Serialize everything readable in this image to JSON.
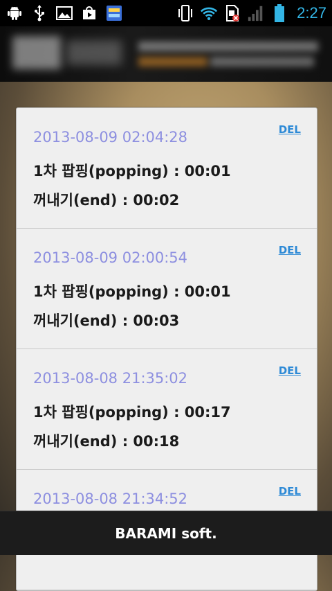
{
  "status_bar": {
    "time": "2:27",
    "left_icons": [
      "android-debug-icon",
      "usb-icon",
      "image-icon",
      "play-store-icon",
      "app-icon"
    ],
    "right_icons": [
      "vibrate-icon",
      "wifi-icon",
      "no-sim-icon",
      "signal-icon",
      "battery-icon"
    ],
    "accent_color": "#33b5e5"
  },
  "records": [
    {
      "date": "2013-08-09 02:04:28",
      "line1": "1차 팝핑(popping) : 00:01",
      "line2": "꺼내기(end) : 00:02",
      "del_label": "DEL"
    },
    {
      "date": "2013-08-09 02:00:54",
      "line1": "1차 팝핑(popping) : 00:01",
      "line2": "꺼내기(end) : 00:03",
      "del_label": "DEL"
    },
    {
      "date": "2013-08-08 21:35:02",
      "line1": "1차 팝핑(popping) : 00:17",
      "line2": "꺼내기(end) : 00:18",
      "del_label": "DEL"
    },
    {
      "date": "2013-08-08 21:34:52",
      "line1": "",
      "line2": "",
      "del_label": "DEL"
    }
  ],
  "colors": {
    "date": "#8d8fe0",
    "del": "#2e8ad6",
    "card_bg": "#efefef"
  },
  "footer": {
    "text": "BARAMI soft."
  }
}
